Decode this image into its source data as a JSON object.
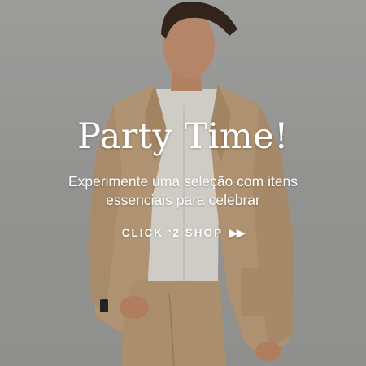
{
  "banner": {
    "headline": "Party Time!",
    "subtitle_line1": "Experimente uma seleção com itens",
    "subtitle_line2": "essenciais para celebrar",
    "cta_label": "CLICK ‘2 SHOP",
    "cta_icon": "double-play-arrows-icon",
    "text_color": "#ffffff",
    "background_color": "#a9a9a7",
    "suit_color": "#c8a882",
    "shirt_color": "#ece9e2"
  }
}
